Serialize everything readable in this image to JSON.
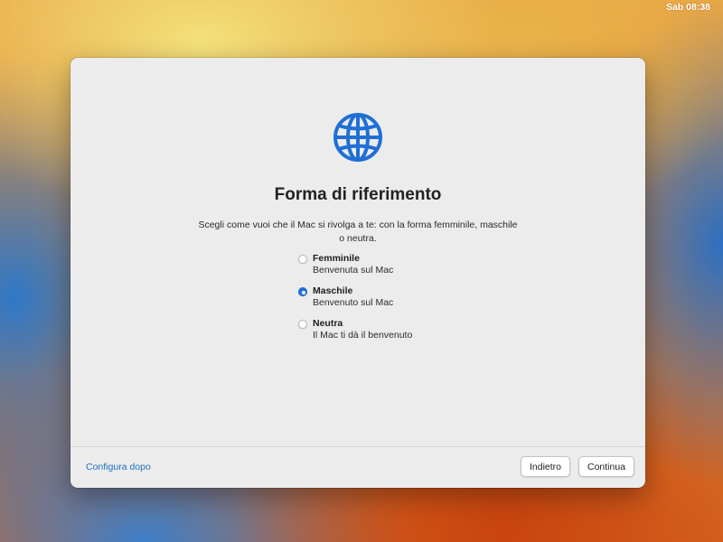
{
  "menubar": {
    "clock": "Sab 08:38"
  },
  "dialog": {
    "icon": "globe-icon",
    "title": "Forma di riferimento",
    "subtitle": "Scegli come vuoi che il Mac si rivolga a te: con la forma femminile, maschile o neutra.",
    "options": [
      {
        "label": "Femminile",
        "description": "Benvenuta sul Mac",
        "selected": false
      },
      {
        "label": "Maschile",
        "description": "Benvenuto sul Mac",
        "selected": true
      },
      {
        "label": "Neutra",
        "description": "Il Mac ti dà il benvenuto",
        "selected": false
      }
    ]
  },
  "footer": {
    "setup_later_link": "Configura dopo",
    "back_button": "Indietro",
    "continue_button": "Continua"
  },
  "colors": {
    "accent": "#1f72d8",
    "link": "#1f6fbf",
    "window_bg": "#ececec"
  }
}
